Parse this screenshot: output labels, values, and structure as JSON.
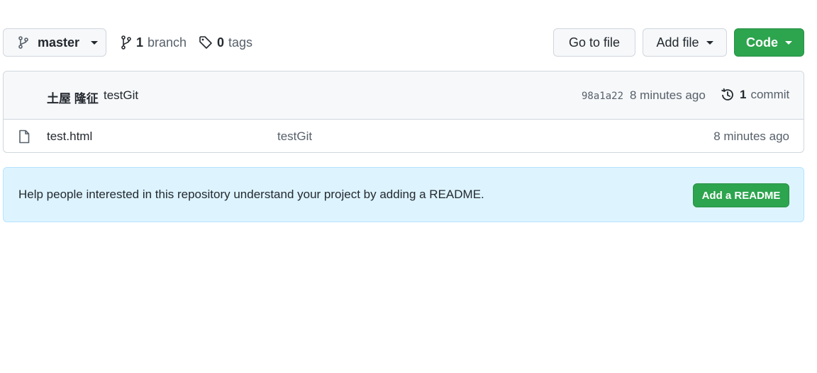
{
  "toolbar": {
    "branch_select": {
      "label": "master",
      "icon": "git-branch-icon"
    },
    "branches": {
      "count": "1",
      "label": "branch",
      "icon": "git-branch-icon"
    },
    "tags": {
      "count": "0",
      "label": "tags",
      "icon": "tag-icon"
    },
    "go_to_file_label": "Go to file",
    "add_file_label": "Add file",
    "code_label": "Code",
    "code_color": "#2da44e"
  },
  "commit": {
    "author": "土屋 隆征",
    "message": "testGit",
    "sha": "98a1a22",
    "time": "8 minutes ago",
    "count": "1",
    "count_label": "commit",
    "icon": "history-icon"
  },
  "files": [
    {
      "name": "test.html",
      "commit_message": "testGit",
      "time": "8 minutes ago",
      "icon": "file-icon"
    }
  ],
  "readme_banner": {
    "text": "Help people interested in this repository understand your project by adding a README.",
    "button_label": "Add a README",
    "background": "#ddf4ff"
  }
}
